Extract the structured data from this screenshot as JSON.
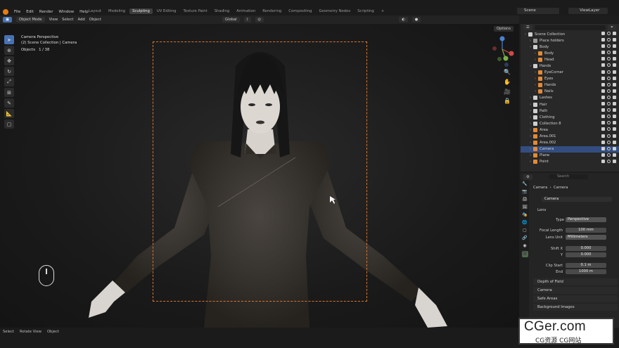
{
  "menu": [
    "File",
    "Edit",
    "Render",
    "Window",
    "Help"
  ],
  "workspaces": [
    "Layout",
    "Modeling",
    "Sculpting",
    "UV Editing",
    "Texture Paint",
    "Shading",
    "Animation",
    "Rendering",
    "Compositing",
    "Geometry Nodes",
    "Scripting"
  ],
  "active_workspace": "Sculpting",
  "scene": "Scene",
  "view_layer": "ViewLayer",
  "header": {
    "mode": "Object Mode",
    "view": "View",
    "select": "Select",
    "add": "Add",
    "object": "Object",
    "orientation": "Global",
    "options": "Options"
  },
  "viewport": {
    "line1": "Camera Perspective",
    "line2": "(2) Scene Collection | Camera",
    "objects_label": "Objects",
    "objects_count": "1 / 38"
  },
  "outliner": {
    "search_placeholder": "",
    "rows": [
      {
        "name": "Scene Collection",
        "indent": 0,
        "color": "#cfcfcf"
      },
      {
        "name": "Place holders",
        "indent": 1,
        "color": "#9a9a9a"
      },
      {
        "name": "Body",
        "indent": 1,
        "color": "#cfcfcf"
      },
      {
        "name": "Body",
        "indent": 2,
        "color": "#e28a37"
      },
      {
        "name": "Head",
        "indent": 2,
        "color": "#e28a37"
      },
      {
        "name": "Hands",
        "indent": 1,
        "color": "#cfcfcf"
      },
      {
        "name": "EyeCorner",
        "indent": 2,
        "color": "#e28a37"
      },
      {
        "name": "Eyes",
        "indent": 2,
        "color": "#e28a37"
      },
      {
        "name": "Hands",
        "indent": 2,
        "color": "#e28a37"
      },
      {
        "name": "Nails",
        "indent": 2,
        "color": "#e28a37"
      },
      {
        "name": "Lashes",
        "indent": 1,
        "color": "#cfcfcf"
      },
      {
        "name": "Hair",
        "indent": 1,
        "color": "#cfcfcf"
      },
      {
        "name": "Path",
        "indent": 1,
        "color": "#cfcfcf"
      },
      {
        "name": "Clothing",
        "indent": 1,
        "color": "#cfcfcf"
      },
      {
        "name": "Collection 8",
        "indent": 1,
        "color": "#cfcfcf"
      },
      {
        "name": "Area",
        "indent": 1,
        "color": "#e28a37"
      },
      {
        "name": "Area.001",
        "indent": 1,
        "color": "#e28a37"
      },
      {
        "name": "Area.002",
        "indent": 1,
        "color": "#e28a37"
      },
      {
        "name": "Camera",
        "indent": 1,
        "color": "#e28a37",
        "selected": true
      },
      {
        "name": "Plane",
        "indent": 1,
        "color": "#e28a37"
      },
      {
        "name": "Point",
        "indent": 1,
        "color": "#e28a37"
      }
    ]
  },
  "properties": {
    "search_placeholder": "Search",
    "breadcrumb_a": "Camera",
    "breadcrumb_b": "Camera",
    "datablock": "Camera",
    "lens_section": "Lens",
    "type_label": "Type",
    "type_value": "Perspective",
    "focal_label": "Focal Length",
    "focal_value": "100 mm",
    "unit_label": "Lens Unit",
    "unit_value": "Millimeters",
    "shiftx_label": "Shift X",
    "shiftx_value": "0.000",
    "shifty_label": "Y",
    "shifty_value": "0.000",
    "clipstart_label": "Clip Start",
    "clipstart_value": "0.1 m",
    "end_label": "End",
    "end_value": "1000 m",
    "sections": [
      "Depth of Field",
      "Camera",
      "Safe Areas",
      "Background Images"
    ]
  },
  "status": [
    "Select",
    "Rotate View",
    "Object"
  ],
  "watermark": {
    "big": "CGer.com",
    "small": "CG资源  CG网站"
  }
}
